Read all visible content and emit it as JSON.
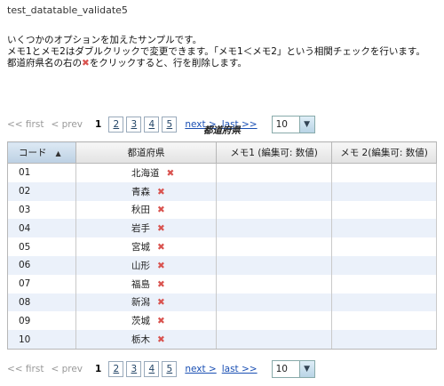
{
  "page_title": "test_datatable_validate5",
  "description": {
    "line1": "いくつかのオプションを加えたサンプルです。",
    "line2": "メモ1とメモ2はダブルクリックで変更できます。「メモ1＜メモ2」という相関チェックを行います。",
    "line3_pre": "都道府県名の右の",
    "line3_mark": "✖",
    "line3_post": "をクリックすると、行を削除します。"
  },
  "pager": {
    "first": "<< first",
    "prev": "< prev",
    "current_page": "1",
    "pages": [
      "2",
      "3",
      "4",
      "5"
    ],
    "next": "next >",
    "last": "last >>",
    "rows_per_page": "10"
  },
  "table": {
    "caption": "都道府県",
    "headers": {
      "code": "コード",
      "prefecture": "都道府県",
      "memo1": "メモ1 (編集可: 数値)",
      "memo2": "メモ 2(編集可: 数値)"
    },
    "sort_indicator": "▲",
    "delete_mark": "✖",
    "rows": [
      {
        "code": "01",
        "prefecture": "北海道"
      },
      {
        "code": "02",
        "prefecture": "青森"
      },
      {
        "code": "03",
        "prefecture": "秋田"
      },
      {
        "code": "04",
        "prefecture": "岩手"
      },
      {
        "code": "05",
        "prefecture": "宮城"
      },
      {
        "code": "06",
        "prefecture": "山形"
      },
      {
        "code": "07",
        "prefecture": "福島"
      },
      {
        "code": "08",
        "prefecture": "新潟"
      },
      {
        "code": "09",
        "prefecture": "茨城"
      },
      {
        "code": "10",
        "prefecture": "栃木"
      }
    ]
  },
  "colors": {
    "delete_mark": "#d9534f",
    "row_alt": "#ebf1fa",
    "link": "#1a4fb3"
  }
}
